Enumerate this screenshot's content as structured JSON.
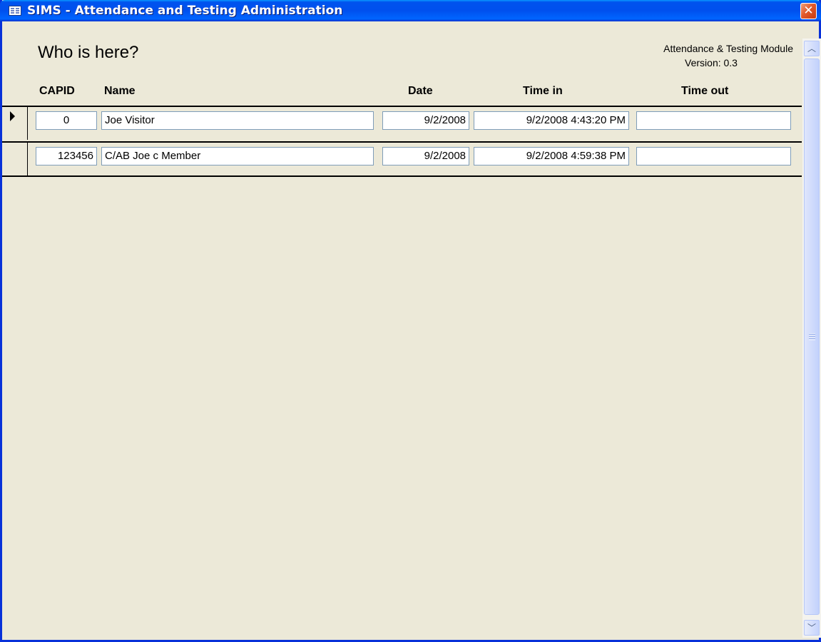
{
  "window": {
    "title": "SIMS - Attendance and Testing Administration",
    "icon": "form-icon",
    "close_label": "✕"
  },
  "form": {
    "heading": "Who is here?",
    "module_name": "Attendance & Testing Module",
    "module_version": "Version:  0.3"
  },
  "columns": {
    "capid": "CAPID",
    "name": "Name",
    "date": "Date",
    "time_in": "Time in",
    "time_out": "Time out"
  },
  "rows": [
    {
      "capid": "0",
      "name": "Joe Visitor",
      "date": "9/2/2008",
      "time_in": "9/2/2008 4:43:20 PM",
      "time_out": "",
      "current": true
    },
    {
      "capid": "123456",
      "name": "C/AB Joe c Member",
      "date": "9/2/2008",
      "time_in": "9/2/2008 4:59:38 PM",
      "time_out": "",
      "current": false
    }
  ],
  "scrollbar": {
    "up_icon": "chevron-up-icon",
    "down_icon": "chevron-down-icon"
  },
  "colors": {
    "titlebar": "#0053ee",
    "form_background": "#ece9d8",
    "close_button": "#e35a2b",
    "field_border": "#7f9db9"
  }
}
